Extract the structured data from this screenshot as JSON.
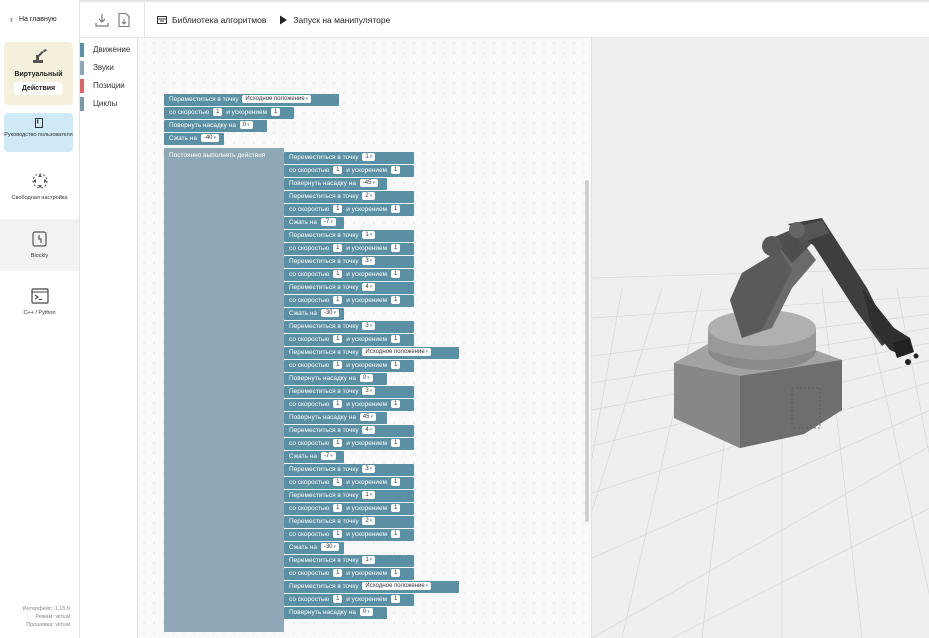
{
  "sidebar": {
    "back_label": "На главную",
    "virtual": {
      "title": "Виртуальный",
      "action": "Действия",
      "icon": "robot-arm-icon"
    },
    "guide": {
      "title": "Руководство пользователя",
      "icon": "book-icon"
    },
    "free": {
      "title": "Свободная настройка",
      "icon": "move-icon"
    },
    "blockly": {
      "title": "Blockly",
      "icon": "puzzle-icon"
    },
    "cpp": {
      "title": "C++ / Python",
      "icon": "terminal-icon"
    },
    "version": {
      "interface": "Интерфейс: 1.15.9",
      "mode": "Режим: virtual",
      "firmware": "Прошивка: virtual"
    }
  },
  "toolbar": {
    "download_icon": "download-icon",
    "file_icon": "file-icon",
    "library_label": "Библиотека алгоритмов",
    "run_label": "Запуск на манипуляторе"
  },
  "categories": [
    {
      "label": "Движение",
      "color": "#5b8fa3"
    },
    {
      "label": "Звуки",
      "color": "#8ea8b8"
    },
    {
      "label": "Позиции",
      "color": "#d46a6a"
    },
    {
      "label": "Циклы",
      "color": "#7a9aa8"
    }
  ],
  "colors": {
    "motion_block": "#5b8fa3",
    "loop_block": "#8ea8b8",
    "accent": "#cfe9f7"
  },
  "blocks": {
    "move_to": "Переместиться в точку",
    "speed": "со скоростью",
    "accel": "и ускорением",
    "rotate": "Повернуть насадку на",
    "grip": "Сжать на",
    "loop": "Постоянно выполнять действия",
    "home": "Исходное положение",
    "one": "1",
    "pre": [
      {
        "kind": "move",
        "point": "Исходное положение"
      },
      {
        "kind": "speed",
        "speed": "1",
        "accel": "1"
      },
      {
        "kind": "rotate",
        "value": "0"
      },
      {
        "kind": "grip",
        "value": "-40"
      }
    ],
    "inner": [
      {
        "kind": "move",
        "point": "1"
      },
      {
        "kind": "speed",
        "speed": "1",
        "accel": "1"
      },
      {
        "kind": "rotate",
        "value": "-45"
      },
      {
        "kind": "move",
        "point": "2"
      },
      {
        "kind": "speed",
        "speed": "1",
        "accel": "1"
      },
      {
        "kind": "grip",
        "value": "-7"
      },
      {
        "kind": "move",
        "point": "1"
      },
      {
        "kind": "speed",
        "speed": "1",
        "accel": "1"
      },
      {
        "kind": "move",
        "point": "3"
      },
      {
        "kind": "speed",
        "speed": "1",
        "accel": "1"
      },
      {
        "kind": "move",
        "point": "4"
      },
      {
        "kind": "speed",
        "speed": "1",
        "accel": "1"
      },
      {
        "kind": "grip",
        "value": "-30"
      },
      {
        "kind": "move",
        "point": "3"
      },
      {
        "kind": "speed",
        "speed": "1",
        "accel": "1"
      },
      {
        "kind": "move",
        "point": "Исходное положение"
      },
      {
        "kind": "speed",
        "speed": "1",
        "accel": "1"
      },
      {
        "kind": "rotate",
        "value": "0"
      },
      {
        "kind": "move",
        "point": "3"
      },
      {
        "kind": "speed",
        "speed": "1",
        "accel": "1"
      },
      {
        "kind": "rotate",
        "value": "45"
      },
      {
        "kind": "move",
        "point": "4"
      },
      {
        "kind": "speed",
        "speed": "1",
        "accel": "1"
      },
      {
        "kind": "grip",
        "value": "-7"
      },
      {
        "kind": "move",
        "point": "3"
      },
      {
        "kind": "speed",
        "speed": "1",
        "accel": "1"
      },
      {
        "kind": "move",
        "point": "1"
      },
      {
        "kind": "speed",
        "speed": "1",
        "accel": "1"
      },
      {
        "kind": "move",
        "point": "2"
      },
      {
        "kind": "speed",
        "speed": "1",
        "accel": "1"
      },
      {
        "kind": "grip",
        "value": "-30"
      },
      {
        "kind": "move",
        "point": "1"
      },
      {
        "kind": "speed",
        "speed": "1",
        "accel": "1"
      },
      {
        "kind": "move",
        "point": "Исходное положение"
      },
      {
        "kind": "speed",
        "speed": "1",
        "accel": "1"
      },
      {
        "kind": "rotate",
        "value": "0"
      }
    ]
  }
}
